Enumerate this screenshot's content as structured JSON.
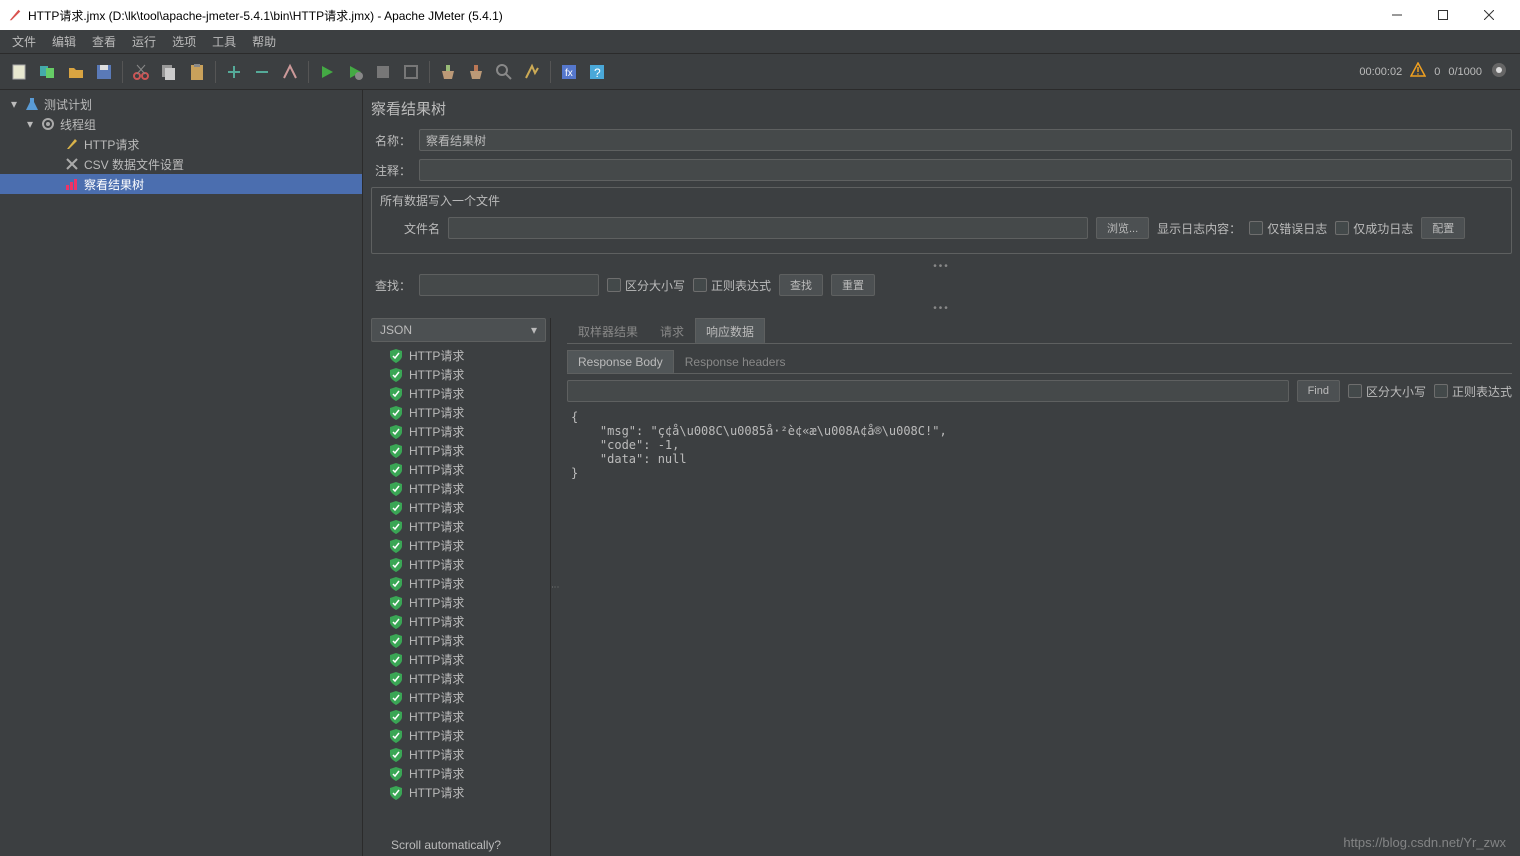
{
  "window": {
    "title": "HTTP请求.jmx (D:\\lk\\tool\\apache-jmeter-5.4.1\\bin\\HTTP请求.jmx) - Apache JMeter (5.4.1)"
  },
  "menubar": [
    "文件",
    "编辑",
    "查看",
    "运行",
    "选项",
    "工具",
    "帮助"
  ],
  "toolbar_status": {
    "timer": "00:00:02",
    "errors": "0",
    "threads": "0/1000"
  },
  "tree": {
    "root": "测试计划",
    "group": "线程组",
    "items": [
      {
        "label": "HTTP请求",
        "icon": "pen"
      },
      {
        "label": "CSV 数据文件设置",
        "icon": "tools"
      },
      {
        "label": "察看结果树",
        "icon": "chart",
        "selected": true
      }
    ]
  },
  "panel": {
    "heading": "察看结果树",
    "name_label": "名称：",
    "name_value": "察看结果树",
    "comment_label": "注释：",
    "filegroup_title": "所有数据写入一个文件",
    "filename_label": "文件名",
    "browse_btn": "浏览...",
    "show_log_label": "显示日志内容：",
    "only_error": "仅错误日志",
    "only_success": "仅成功日志",
    "config_btn": "配置",
    "search_label": "查找：",
    "case_sensitive": "区分大小写",
    "regex": "正则表达式",
    "search_btn": "查找",
    "reset_btn": "重置"
  },
  "renderer": "JSON",
  "result_item_label": "HTTP请求",
  "result_count": 24,
  "scroll_auto": "Scroll automatically?",
  "detail_tabs": [
    "取样器结果",
    "请求",
    "响应数据"
  ],
  "sub_tabs": [
    "Response Body",
    "Response headers"
  ],
  "find": {
    "btn": "Find",
    "case": "区分大小写",
    "regex": "正则表达式"
  },
  "response_body": "{\n    \"msg\": \"ç¢å\\u008C\\u0085å·²è¢«æ\\u008A¢å®\\u008C!\",\n    \"code\": -1,\n    \"data\": null\n}",
  "watermark": "https://blog.csdn.net/Yr_zwx"
}
